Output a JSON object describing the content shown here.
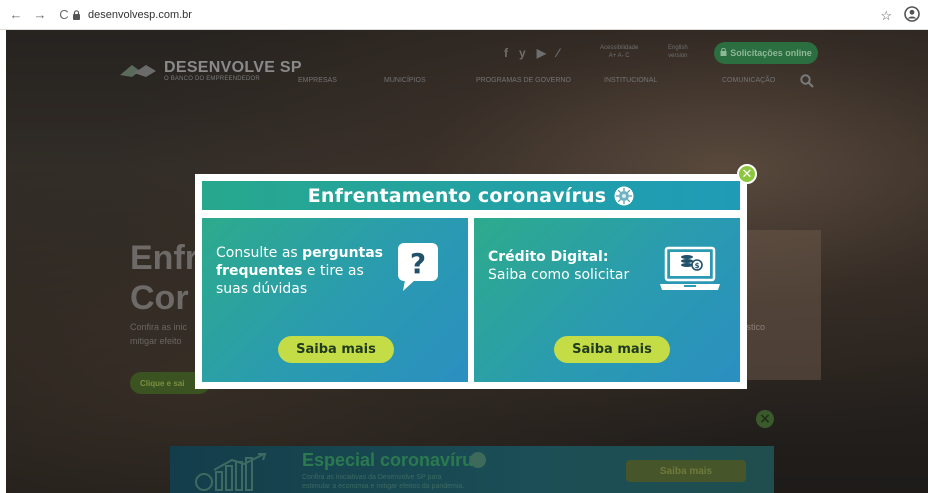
{
  "browser": {
    "url": "desenvolvesp.com.br",
    "back": "←",
    "forward": "→",
    "reload": "C",
    "star": "☆"
  },
  "header": {
    "logo_name": "DESENVOLVE SP",
    "logo_tagline": "O BANCO DO EMPREENDEDOR",
    "accessibility_line1": "Acessibilidade",
    "accessibility_line2": "A+ A- C",
    "english_line1": "English",
    "english_line2": "version",
    "solicitacoes": "Solicitações online",
    "menu": [
      "EMPRESAS",
      "MUNICÍPIOS",
      "PROGRAMAS DE GOVERNO",
      "INSTITUCIONAL",
      "COMUNICAÇÃO"
    ],
    "social": [
      "f",
      "y",
      "▶",
      "⁄"
    ]
  },
  "hero": {
    "title_line1": "Enfr",
    "title_line2": "Cor",
    "subtitle_line1": "Confira as inic",
    "subtitle_line2": "mitigar efeito",
    "right_text": "ístico",
    "button": "Clique e sai"
  },
  "modal": {
    "title": "Enfrentamento coronavírus",
    "card1": {
      "text_a": "Consulte as ",
      "text_b": "perguntas",
      "text_c": "frequentes",
      "text_d": " e tire as",
      "text_e": "suas dúvidas",
      "button": "Saiba mais"
    },
    "card2": {
      "heading": "Crédito Digital:",
      "text": "Saiba como solicitar",
      "button": "Saiba mais"
    }
  },
  "banner": {
    "title": "Especial coronavírus",
    "text_line1": "Confira as iniciativas da Desenvolve SP para",
    "text_line2": "estimular a economia e mitigar efeitos da pandemia.",
    "button": "Saiba mais"
  }
}
